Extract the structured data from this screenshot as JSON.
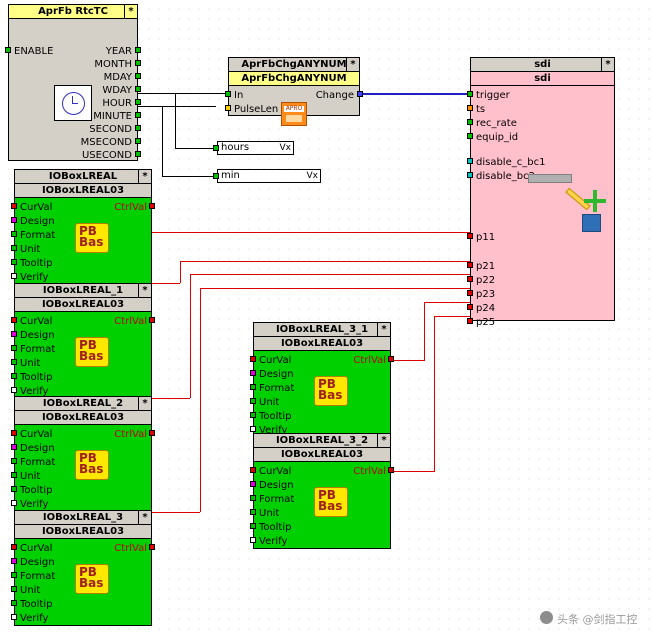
{
  "blocks": {
    "rtctc": {
      "title": "AprFb    RtcTC",
      "star": "*",
      "ports_left": [
        {
          "label": "ENABLE",
          "pin": "green"
        }
      ],
      "ports_right": [
        {
          "label": "YEAR",
          "pin": "green"
        },
        {
          "label": "MONTH",
          "pin": "green"
        },
        {
          "label": "MDAY",
          "pin": "green"
        },
        {
          "label": "WDAY",
          "pin": "green"
        },
        {
          "label": "HOUR",
          "pin": "green"
        },
        {
          "label": "MINUTE",
          "pin": "green"
        },
        {
          "label": "SECOND",
          "pin": "green"
        },
        {
          "label": "MSECOND",
          "pin": "green"
        },
        {
          "label": "USECOND",
          "pin": "green"
        }
      ]
    },
    "chganynum": {
      "title": "AprFbChgANYNUM",
      "star": "*",
      "subtitle": "AprFbChgANYNUM",
      "ports_left": [
        {
          "label": "In",
          "pin": "green"
        },
        {
          "label": "PulseLen",
          "pin": "yellow"
        }
      ],
      "ports_right": [
        {
          "label": "Change",
          "pin": "blue"
        }
      ]
    },
    "sdi": {
      "title": "sdi",
      "star": "*",
      "subtitle": "sdi",
      "ports_left": [
        {
          "label": "trigger",
          "pin": "green"
        },
        {
          "label": "ts",
          "pin": "orange"
        },
        {
          "label": "rec_rate",
          "pin": "green"
        },
        {
          "label": "equip_id",
          "pin": "green"
        },
        {
          "label": "disable_c_bc1",
          "pin": "cyan"
        },
        {
          "label": "disable_bc2",
          "pin": "cyan"
        },
        {
          "label": "p11",
          "pin": "red"
        },
        {
          "label": "p21",
          "pin": "red"
        },
        {
          "label": "p22",
          "pin": "red"
        },
        {
          "label": "p23",
          "pin": "red"
        },
        {
          "label": "p24",
          "pin": "red"
        },
        {
          "label": "p25",
          "pin": "red"
        }
      ]
    },
    "iobox_common": {
      "subtitle": "IOBoxLREAL03",
      "ports": [
        {
          "label": "CurVal",
          "pin": "red",
          "right_label": "CtrlVal"
        },
        {
          "label": "Design",
          "pin": "magenta"
        },
        {
          "label": "Format",
          "pin": "green"
        },
        {
          "label": "Unit",
          "pin": "green"
        },
        {
          "label": "Tooltip",
          "pin": "green"
        },
        {
          "label": "Verify",
          "pin": "white"
        }
      ],
      "icon": {
        "top": "PB",
        "bottom": "Bas"
      }
    },
    "ioboxes": [
      {
        "title": "IOBoxLREAL",
        "star": "*"
      },
      {
        "title": "IOBoxLREAL_1",
        "star": "*"
      },
      {
        "title": "IOBoxLREAL_2",
        "star": "*"
      },
      {
        "title": "IOBoxLREAL_3",
        "star": "*"
      },
      {
        "title": "IOBoxLREAL_3_1",
        "star": "*"
      },
      {
        "title": "IOBoxLREAL_3_2",
        "star": "*"
      }
    ]
  },
  "textboxes": [
    {
      "value": "hours",
      "suffix": "Vx"
    },
    {
      "value": "min",
      "suffix": "Vx"
    }
  ],
  "watermark": {
    "text": "头条 @剑指工控"
  }
}
